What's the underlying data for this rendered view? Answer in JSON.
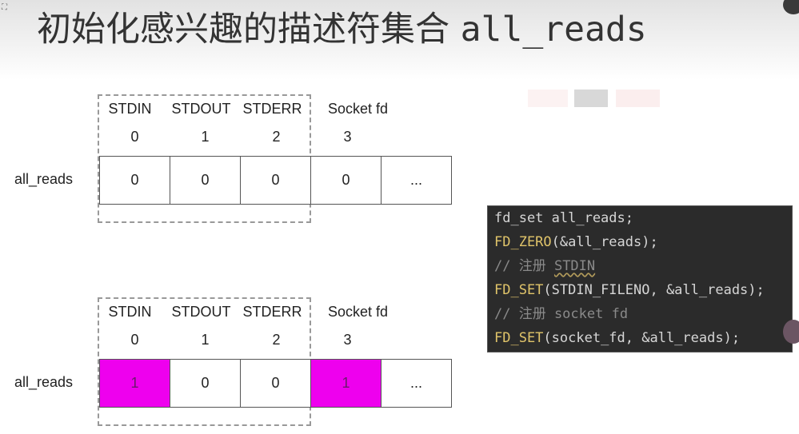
{
  "title": {
    "text_cn": "初始化感兴趣的描述符集合 ",
    "text_code": "all_reads"
  },
  "columns": [
    {
      "name": "STDIN",
      "index": "0"
    },
    {
      "name": "STDOUT",
      "index": "1"
    },
    {
      "name": "STDERR",
      "index": "2"
    },
    {
      "name": "Socket fd",
      "index": "3"
    }
  ],
  "diagram_before": {
    "row_label": "all_reads",
    "cells": [
      "0",
      "0",
      "0",
      "0",
      "..."
    ]
  },
  "diagram_after": {
    "row_label": "all_reads",
    "cells": [
      "1",
      "0",
      "0",
      "1",
      "..."
    ]
  },
  "code": {
    "line1": "fd_set all_reads;",
    "line2_fn": "FD_ZERO",
    "line2_args": "(&all_reads);",
    "line3_comment": "// 注册 ",
    "line3_squiggle": "STDIN",
    "line4_fn": "FD_SET",
    "line4_args": "(STDIN_FILENO, &all_reads);",
    "line5_comment": "// 注册 socket fd",
    "line6_fn": "FD_SET",
    "line6_args": "(socket_fd, &all_reads);"
  },
  "colors": {
    "set_cell": "#ee00ee",
    "code_bg": "#2b2b2b",
    "code_keyword": "#e0c46a",
    "code_comment": "#8a8a8a"
  }
}
